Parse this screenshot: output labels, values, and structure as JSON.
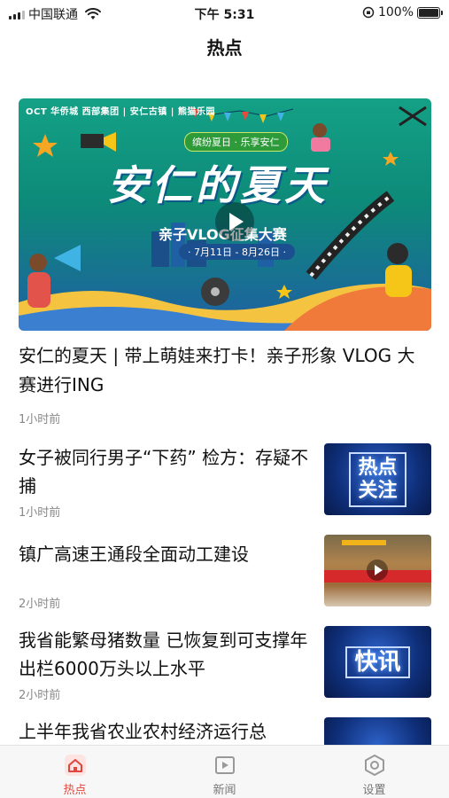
{
  "status_bar": {
    "carrier": "中国联通",
    "time": "下午 5:31",
    "battery": "100%"
  },
  "page_title": "热点",
  "feature": {
    "banner": {
      "logo_text": "OCT 华侨城 西部集团 | 安仁古镇 | 熊猫乐园",
      "tagline": "缤纷夏日 · 乐享安仁",
      "headline": "安仁的夏天",
      "subtitle": "亲子VLOG征集大赛",
      "dates": "· 7月11日 - 8月26日 ·"
    },
    "title": "安仁的夏天 | 带上萌娃来打卡！亲子形象 VLOG 大赛进行ING",
    "time": "1小时前"
  },
  "news": [
    {
      "title": "女子被同行男子“下药” 检方：存疑不捕",
      "time": "1小时前",
      "thumb_label": "热点关注",
      "thumb_label_line1": "热点",
      "thumb_label_line2": "关注"
    },
    {
      "title": "镇广高速王通段全面动工建设",
      "time": "2小时前"
    },
    {
      "title": "我省能繁母猪数量 已恢复到可支撑年出栏6000万头以上水平",
      "time": "2小时前",
      "thumb_label": "快讯"
    },
    {
      "title": "上半年我省农业农村经济运行总"
    }
  ],
  "tabs": [
    {
      "label": "热点",
      "icon": "home-icon",
      "active": true
    },
    {
      "label": "新闻",
      "icon": "video-icon",
      "active": false
    },
    {
      "label": "设置",
      "icon": "settings-icon",
      "active": false
    }
  ],
  "colors": {
    "accent": "#e0463d",
    "tab_inactive": "#777777"
  }
}
